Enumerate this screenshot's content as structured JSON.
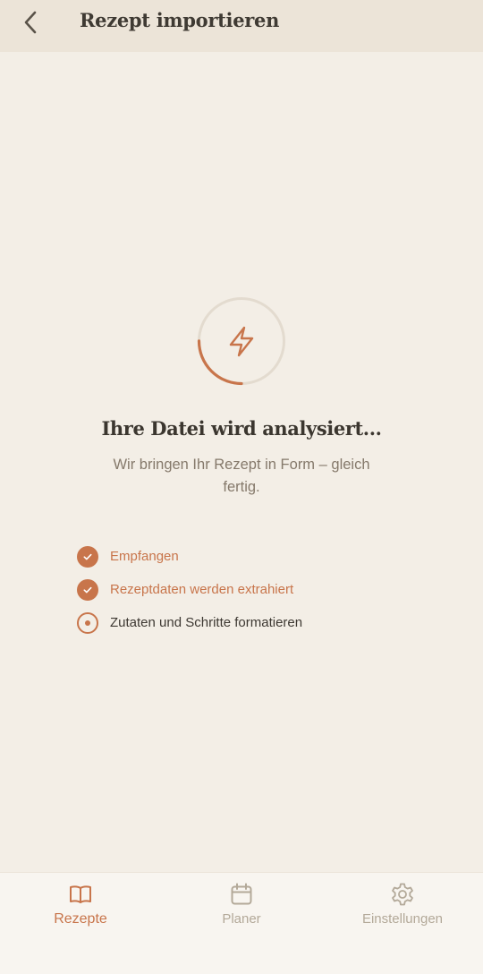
{
  "header": {
    "title": "Rezept importieren"
  },
  "status": {
    "title": "Ihre Datei wird analysiert...",
    "subtitle": "Wir bringen Ihr Rezept in Form – gleich fertig."
  },
  "progress": {
    "fraction": 0.25
  },
  "steps": [
    {
      "label": "Empfangen",
      "state": "done"
    },
    {
      "label": "Rezeptdaten werden extrahiert",
      "state": "done"
    },
    {
      "label": "Zutaten und Schritte formatieren",
      "state": "active"
    }
  ],
  "tabs": [
    {
      "label": "Rezepte",
      "icon": "book-icon",
      "active": true
    },
    {
      "label": "Planer",
      "icon": "calendar-icon",
      "active": false
    },
    {
      "label": "Einstellungen",
      "icon": "gear-icon",
      "active": false
    }
  ],
  "colors": {
    "accent": "#c8754b",
    "background": "#f3eee6",
    "header": "#ece4d8",
    "text": "#3b362f",
    "muted": "#85796b",
    "inactive_tab": "#b3a999"
  }
}
